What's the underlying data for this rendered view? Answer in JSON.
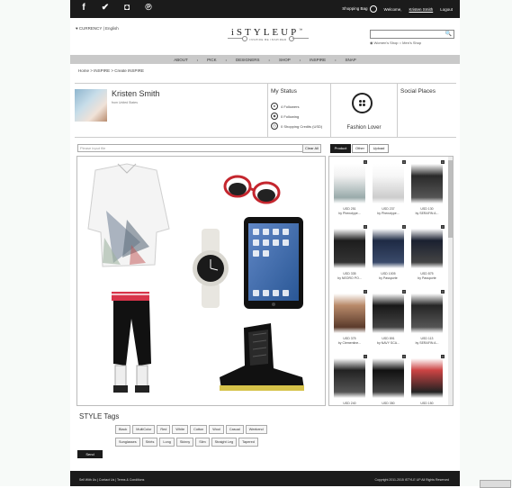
{
  "topbar": {
    "social_icons": [
      "f",
      "✔",
      "◘",
      "℗"
    ],
    "shopping_bag": "Shopping Bag",
    "welcome": "Welcome,",
    "user_name": "Kristen Smith",
    "logout": "Logout"
  },
  "header": {
    "currency": "♥ CURRENCY | English",
    "logo_title": "iSTYLEUP",
    "logo_sub": "INSPIRE BE INSPIRED",
    "logo_tm": "™",
    "search_placeholder": "",
    "shop_type": "◉ Women's Shop ○ Men's Shop"
  },
  "nav": {
    "items": [
      "ABOUT",
      "PICK",
      "DESIGNERS",
      "SHOP",
      "INSPIRE",
      "SNAP"
    ]
  },
  "breadcrumb": "Home > INSPIRE > Create INSPIRE",
  "profile": {
    "name": "Kristen Smith",
    "from": "from United States",
    "status_title": "My Status",
    "followers": "4 Followers",
    "following": "0 Following",
    "credits": "0 Shopping Credits (USD)",
    "badge": "Fashion Lover",
    "social_places": "Social Places"
  },
  "toolbar": {
    "url_placeholder": "Please input file",
    "clear_all": "Clear All",
    "tabs": [
      "Product",
      "Other",
      "Upload"
    ],
    "active_tab": "Product"
  },
  "products": [
    {
      "price": "USD 251",
      "brand": "by Phenotype..."
    },
    {
      "price": "USD 237",
      "brand": "by Phenotype..."
    },
    {
      "price": "USD 130",
      "brand": "by SERAFIN A..."
    },
    {
      "price": "USD 335",
      "brand": "by NEORO PO..."
    },
    {
      "price": "USD 1005",
      "brand": "by Passporte"
    },
    {
      "price": "USD 875",
      "brand": "by Passporte"
    },
    {
      "price": "USD 375",
      "brand": "by Clementine..."
    },
    {
      "price": "USD 891",
      "brand": "by NAVY SCA..."
    },
    {
      "price": "USD 113",
      "brand": "by SERAFIN A..."
    },
    {
      "price": "USD 240",
      "brand": "by SERAFIN A..."
    },
    {
      "price": "USD 350",
      "brand": "by Clementine..."
    },
    {
      "price": "USD 150",
      "brand": "by WHITE BLA..."
    }
  ],
  "tags": {
    "title": "STYLE Tags",
    "row1": [
      "Black",
      "MultiColor",
      "Red",
      "White",
      "Cotton",
      "Wool",
      "Casual",
      "Weekend"
    ],
    "row2": [
      "Sunglasses",
      "Shirts",
      "Long",
      "Skinny",
      "Slim",
      "Straight Leg",
      "Tapered"
    ],
    "send": "Send"
  },
  "footer": {
    "left": "Sell With Us  |  Contact Us  |  Terms & Conditions",
    "right": "Copyright 2011-2015 iSTYLE UP All Rights Reserved"
  }
}
